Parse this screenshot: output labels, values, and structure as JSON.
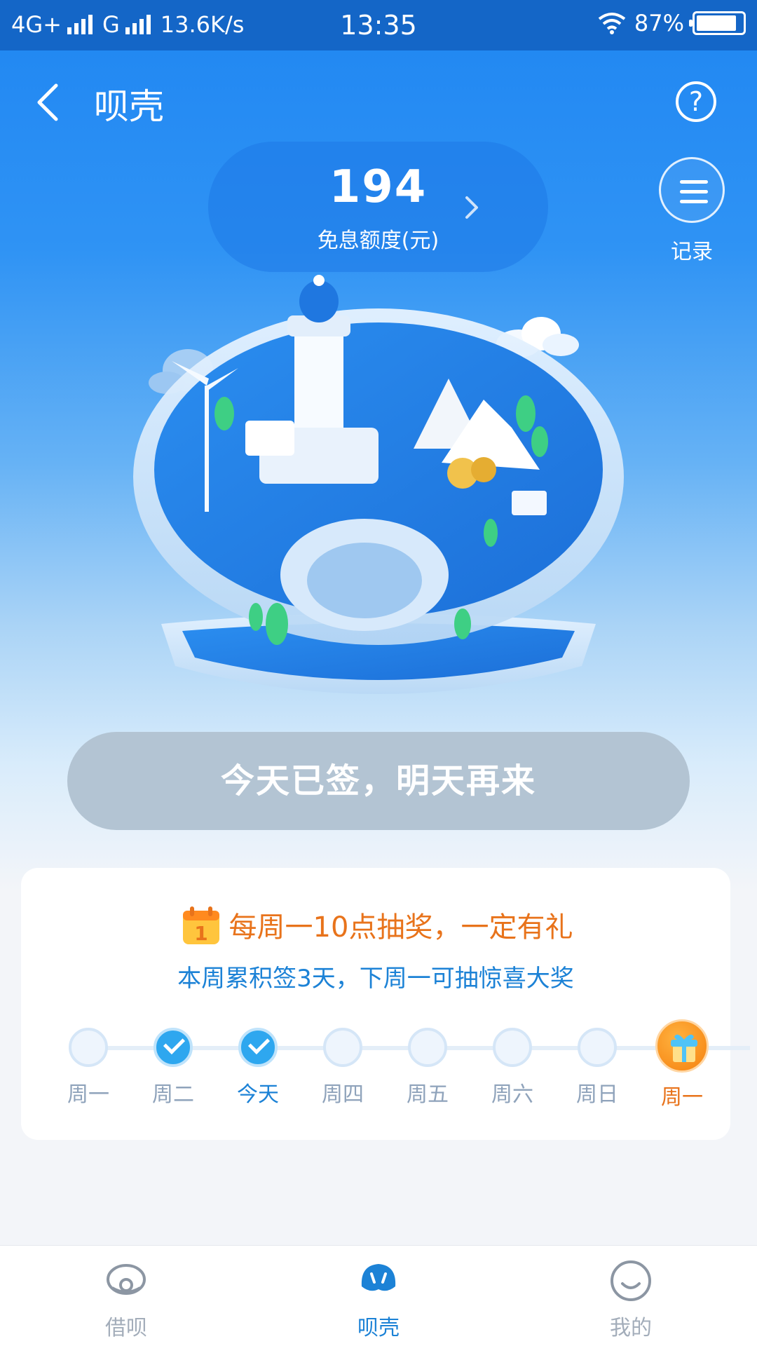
{
  "status_bar": {
    "network1": "4G+",
    "network2": "G",
    "speed": "13.6K/s",
    "time": "13:35",
    "battery": "87%",
    "battery_level": 0.87
  },
  "header": {
    "title": "呗壳",
    "back_icon": "chevron-left-icon",
    "help_label": "?"
  },
  "quota": {
    "value": "194",
    "label": "免息额度(元)"
  },
  "record": {
    "label": "记录"
  },
  "signin_button": "今天已签，明天再来",
  "lottery_card": {
    "title": "每周一10点抽奖，一定有礼",
    "subtitle": "本周累积签3天，下周一可抽惊喜大奖",
    "days": [
      {
        "label": "周一",
        "checked": false
      },
      {
        "label": "周二",
        "checked": true
      },
      {
        "label": "今天",
        "checked": true
      },
      {
        "label": "周四",
        "checked": false
      },
      {
        "label": "周五",
        "checked": false
      },
      {
        "label": "周六",
        "checked": false
      },
      {
        "label": "周日",
        "checked": false
      }
    ],
    "reward_day": "周一"
  },
  "tabbar": {
    "items": [
      {
        "label": "借呗",
        "icon": "pearl-shell-icon"
      },
      {
        "label": "呗壳",
        "icon": "shell-icon"
      },
      {
        "label": "我的",
        "icon": "smiley-icon"
      }
    ],
    "active": 1
  },
  "colors": {
    "primary": "#1c82d6",
    "status_bar": "#1466c7",
    "accent_orange": "#e8731b",
    "disabled_button": "#b3c4d3"
  }
}
